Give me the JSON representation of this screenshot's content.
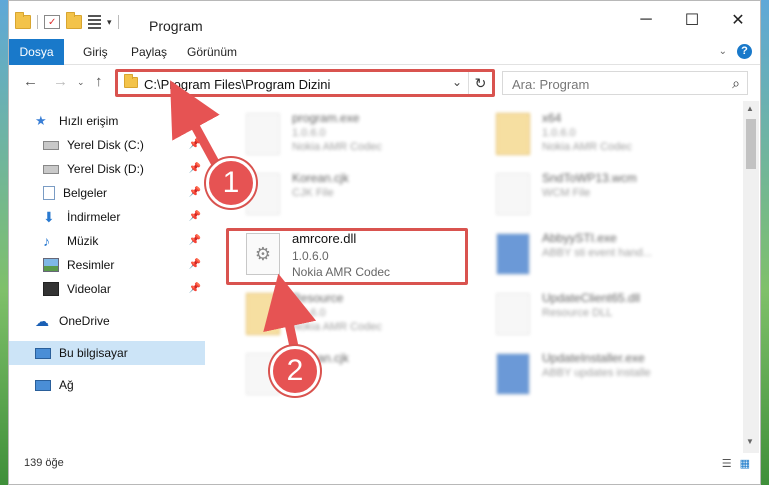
{
  "window": {
    "title": "Program"
  },
  "ribbon": {
    "tabs": [
      "Dosya",
      "Giriş",
      "Paylaş",
      "Görünüm"
    ]
  },
  "address": {
    "path": "C:\\Program Files\\Program Dizini"
  },
  "search": {
    "placeholder": "Ara: Program"
  },
  "sidebar": {
    "items": [
      {
        "label": "Hızlı erişim"
      },
      {
        "label": "Yerel Disk (C:)"
      },
      {
        "label": "Yerel Disk (D:)"
      },
      {
        "label": "Belgeler"
      },
      {
        "label": "İndirmeler"
      },
      {
        "label": "Müzik"
      },
      {
        "label": "Resimler"
      },
      {
        "label": "Videolar"
      },
      {
        "label": "OneDrive"
      },
      {
        "label": "Bu bilgisayar"
      },
      {
        "label": "Ağ"
      }
    ]
  },
  "files": [
    {
      "name": "program.exe",
      "ver": "1.0.6.0",
      "desc": "Nokia AMR Codec"
    },
    {
      "name": "x64",
      "ver": "1.0.6.0",
      "desc": "Nokia AMR Codec"
    },
    {
      "name": "Korean.cjk",
      "ver": "CJK File",
      "desc": ""
    },
    {
      "name": "SndToWP13.wcm",
      "ver": "WCM File",
      "desc": ""
    },
    {
      "name": "amrcore.dll",
      "ver": "1.0.6.0",
      "desc": "Nokia AMR Codec"
    },
    {
      "name": "AbbyySTI.exe",
      "ver": "ABBY sti event hand...",
      "desc": ""
    },
    {
      "name": "Resource",
      "ver": "1.0.6.0",
      "desc": "Nokia AMR Codec"
    },
    {
      "name": "UpdateClient65.dll",
      "ver": "Resource DLL",
      "desc": ""
    },
    {
      "name": "Korean.cjk",
      "ver": "",
      "desc": ""
    },
    {
      "name": "UpdateInstaller.exe",
      "ver": "ABBY updates installe",
      "desc": ""
    }
  ],
  "status": {
    "count": "139 öğe"
  },
  "callouts": {
    "one": "1",
    "two": "2"
  }
}
